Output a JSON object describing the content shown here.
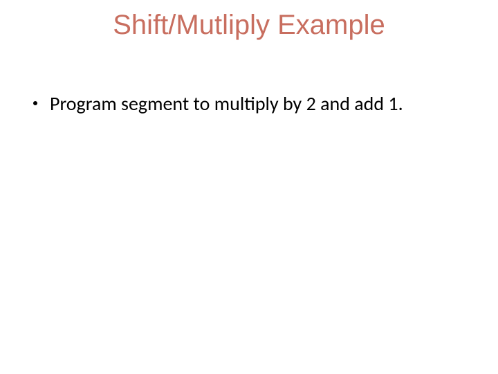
{
  "slide": {
    "title": "Shift/Mutliply Example",
    "bullets": [
      "Program segment to multiply by 2 and add 1."
    ]
  }
}
